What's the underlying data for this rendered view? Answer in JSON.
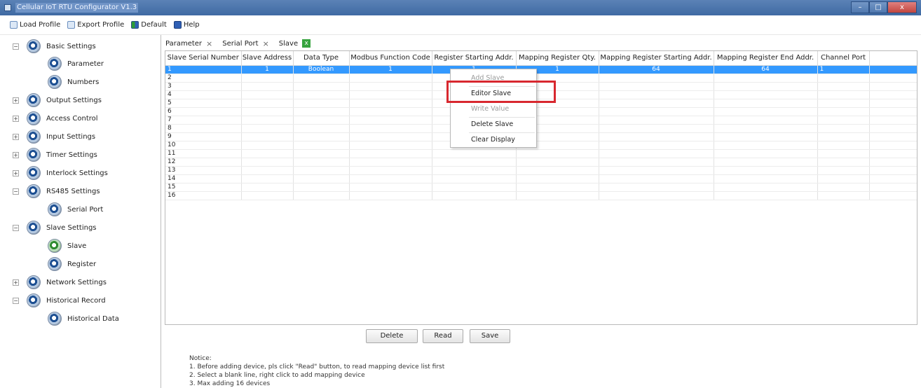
{
  "window": {
    "title": "Cellular IoT RTU Configurator V1.3",
    "minimize": "–",
    "maximize": "□",
    "close": "x"
  },
  "menubar": {
    "load_profile": "Load Profile",
    "export_profile": "Export Profile",
    "default": "Default",
    "help": "Help"
  },
  "sidebar": {
    "basic_settings": "Basic Settings",
    "parameter": "Parameter",
    "numbers": "Numbers",
    "output_settings": "Output Settings",
    "access_control": "Access Control",
    "input_settings": "Input Settings",
    "timer_settings": "Timer Settings",
    "interlock_settings": "Interlock Settings",
    "rs485_settings": "RS485 Settings",
    "serial_port": "Serial Port",
    "slave_settings": "Slave Settings",
    "slave": "Slave",
    "register": "Register",
    "network_settings": "Network Settings",
    "historical_record": "Historical Record",
    "historical_data": "Historical Data"
  },
  "tabs": {
    "parameter": "Parameter",
    "serial_port": "Serial Port",
    "slave": "Slave",
    "close": "×",
    "active_close": "x"
  },
  "table": {
    "headers": [
      "Slave Serial Number",
      "Slave Address",
      "Data Type",
      "Modbus Function Code",
      "Register Starting Addr.",
      "Mapping Register Qty.",
      "Mapping Register Starting Addr.",
      "Mapping Register End Addr.",
      "Channel Port"
    ],
    "rows": [
      [
        "1",
        "1",
        "Boolean",
        "1",
        "1",
        "1",
        "64",
        "64",
        "1"
      ],
      [
        "2",
        "",
        "",
        "",
        "",
        "",
        "",
        "",
        ""
      ],
      [
        "3",
        "",
        "",
        "",
        "",
        "",
        "",
        "",
        ""
      ],
      [
        "4",
        "",
        "",
        "",
        "",
        "",
        "",
        "",
        ""
      ],
      [
        "5",
        "",
        "",
        "",
        "",
        "",
        "",
        "",
        ""
      ],
      [
        "6",
        "",
        "",
        "",
        "",
        "",
        "",
        "",
        ""
      ],
      [
        "7",
        "",
        "",
        "",
        "",
        "",
        "",
        "",
        ""
      ],
      [
        "8",
        "",
        "",
        "",
        "",
        "",
        "",
        "",
        ""
      ],
      [
        "9",
        "",
        "",
        "",
        "",
        "",
        "",
        "",
        ""
      ],
      [
        "10",
        "",
        "",
        "",
        "",
        "",
        "",
        "",
        ""
      ],
      [
        "11",
        "",
        "",
        "",
        "",
        "",
        "",
        "",
        ""
      ],
      [
        "12",
        "",
        "",
        "",
        "",
        "",
        "",
        "",
        ""
      ],
      [
        "13",
        "",
        "",
        "",
        "",
        "",
        "",
        "",
        ""
      ],
      [
        "14",
        "",
        "",
        "",
        "",
        "",
        "",
        "",
        ""
      ],
      [
        "15",
        "",
        "",
        "",
        "",
        "",
        "",
        "",
        ""
      ],
      [
        "16",
        "",
        "",
        "",
        "",
        "",
        "",
        "",
        ""
      ]
    ]
  },
  "context_menu": {
    "add_slave": "Add Slave",
    "editor_slave": "Editor Slave",
    "write_value": "Write Value",
    "delete_slave": "Delete Slave",
    "clear_display": "Clear Display"
  },
  "buttons": {
    "delete": "Delete",
    "read": "Read",
    "save": "Save"
  },
  "notice": {
    "title": "Notice:",
    "line1": "1. Before adding device, pls click \"Read\" button, to read mapping device list first",
    "line2": "2. Select a blank line, right click to add mapping device",
    "line3": "3. Max adding 16 devices"
  },
  "colors": {
    "selection": "#3399ff",
    "highlight": "#d8282f",
    "titlebar": "#4a74ab"
  }
}
